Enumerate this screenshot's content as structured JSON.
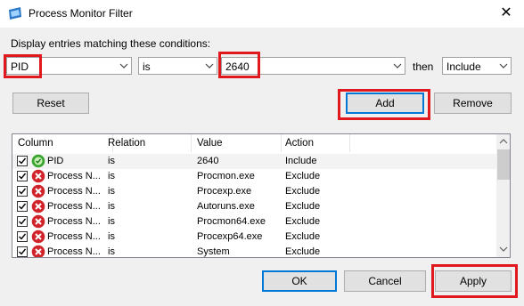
{
  "window": {
    "title": "Process Monitor Filter",
    "close_glyph": "✕"
  },
  "conditions": {
    "label": "Display entries matching these conditions:",
    "column_value": "PID",
    "relation_value": "is",
    "value_value": "2640",
    "then_label": "then",
    "action_value": "Include"
  },
  "buttons": {
    "reset": "Reset",
    "add": "Add",
    "remove": "Remove",
    "ok": "OK",
    "cancel": "Cancel",
    "apply": "Apply"
  },
  "list": {
    "headers": [
      "Column",
      "Relation",
      "Value",
      "Action"
    ],
    "rows": [
      {
        "column": "PID",
        "relation": "is",
        "value": "2640",
        "action": "Include",
        "icon": "include-icon",
        "checked": true
      },
      {
        "column": "Process N...",
        "relation": "is",
        "value": "Procmon.exe",
        "action": "Exclude",
        "icon": "exclude-icon",
        "checked": true
      },
      {
        "column": "Process N...",
        "relation": "is",
        "value": "Procexp.exe",
        "action": "Exclude",
        "icon": "exclude-icon",
        "checked": true
      },
      {
        "column": "Process N...",
        "relation": "is",
        "value": "Autoruns.exe",
        "action": "Exclude",
        "icon": "exclude-icon",
        "checked": true
      },
      {
        "column": "Process N...",
        "relation": "is",
        "value": "Procmon64.exe",
        "action": "Exclude",
        "icon": "exclude-icon",
        "checked": true
      },
      {
        "column": "Process N...",
        "relation": "is",
        "value": "Procexp64.exe",
        "action": "Exclude",
        "icon": "exclude-icon",
        "checked": true
      },
      {
        "column": "Process N...",
        "relation": "is",
        "value": "System",
        "action": "Exclude",
        "icon": "exclude-icon",
        "checked": true
      }
    ]
  },
  "colors": {
    "highlight_red": "#e0191f",
    "include_green": "#3aa52f",
    "exclude_red": "#d0242a"
  }
}
